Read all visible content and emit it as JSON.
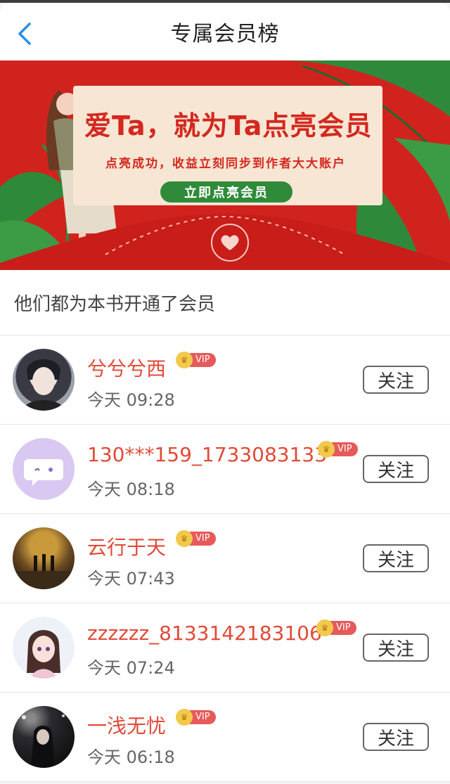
{
  "header": {
    "title": "专属会员榜"
  },
  "banner": {
    "headline": "爱Ta，就为Ta点亮会员",
    "subtitle": "点亮成功，收益立刻同步到作者大大账户",
    "cta_label": "立即点亮会员"
  },
  "section_label": "他们都为本书开通了会员",
  "vip_label": "VIP",
  "follow_label": "关注",
  "members": [
    {
      "name": "兮兮兮西",
      "time": "今天 09:28"
    },
    {
      "name": "130***159_1733083133",
      "time": "今天 08:18"
    },
    {
      "name": "云行于天",
      "time": "今天 07:43"
    },
    {
      "name": "zzzzzz_8133142183106",
      "time": "今天 07:24"
    },
    {
      "name": "一浅无忧",
      "time": "今天 06:18"
    }
  ],
  "colors": {
    "accent": "#e14a38",
    "banner_red": "#d1231e",
    "back_arrow": "#2a8fe6",
    "vip_badge": "#e65a5a",
    "crown": "#f2c94c"
  }
}
